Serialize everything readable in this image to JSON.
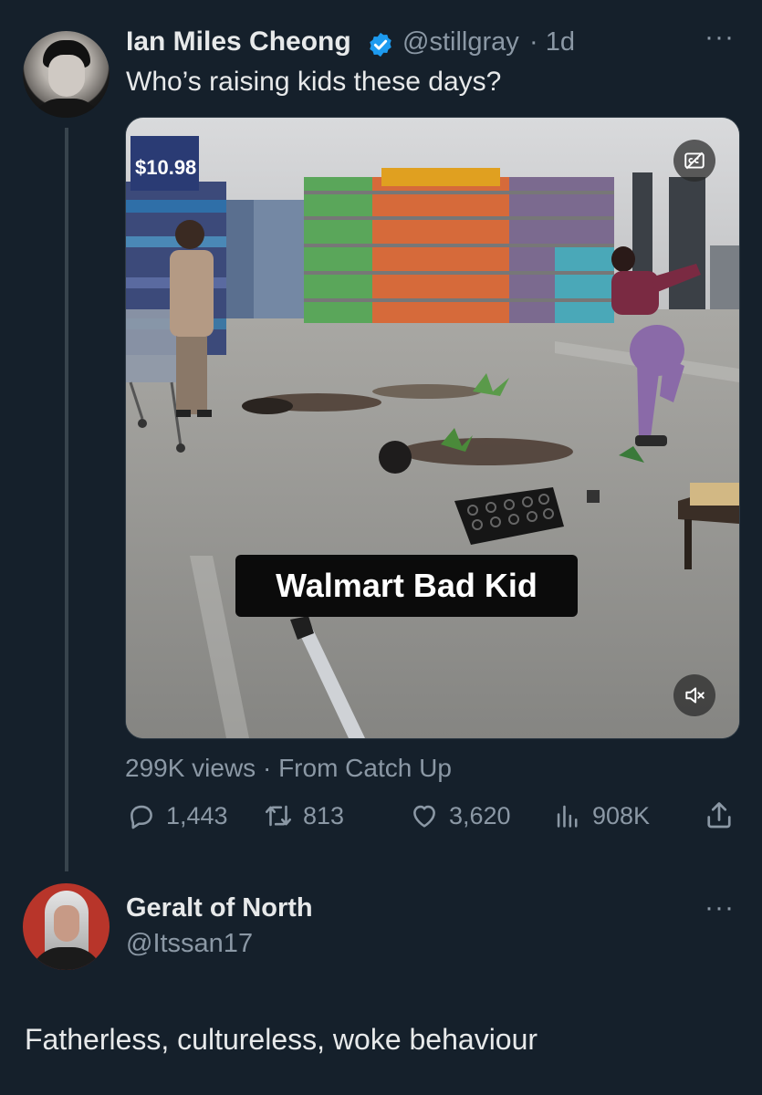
{
  "tweet": {
    "author_name": "Ian Miles Cheong",
    "author_handle": "@stillgray",
    "time": "· 1d",
    "text": "Who’s raising kids these days?",
    "more_label": "···",
    "media": {
      "caption": "Walmart Bad Kid",
      "price_tag": "$10.98",
      "cc_icon": "closed-captions-icon",
      "mute_icon": "muted-speaker-icon"
    },
    "meta": "299K views · From Catch Up",
    "stats": {
      "replies": "1,443",
      "retweets": "813",
      "likes": "3,620",
      "views": "908K"
    }
  },
  "reply": {
    "author_name": "Geralt of North",
    "author_handle": "@Itssan17",
    "more_label": "···",
    "text": "Fatherless, cultureless, woke behaviour"
  },
  "colors": {
    "background": "#15202b",
    "text_primary": "#e7e9ea",
    "text_secondary": "#8b98a5",
    "verified_blue": "#1d9bf0",
    "thread_line": "#38444d"
  }
}
